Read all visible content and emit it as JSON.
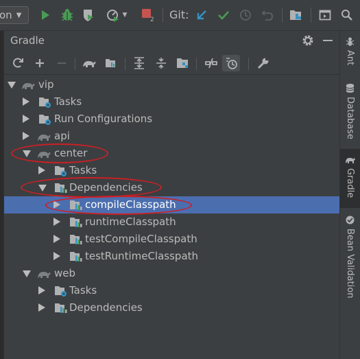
{
  "toolbar": {
    "run_config_label": "on",
    "git_label": "Git:",
    "notification_count": "2"
  },
  "panel": {
    "title": "Gradle"
  },
  "tree": {
    "vip": "vip",
    "vip_tasks": "Tasks",
    "vip_runconf": "Run Configurations",
    "api": "api",
    "center": "center",
    "center_tasks": "Tasks",
    "center_deps": "Dependencies",
    "compileClasspath": "compileClasspath",
    "runtimeClasspath": "runtimeClasspath",
    "testCompileClasspath": "testCompileClasspath",
    "testRuntimeClasspath": "testRuntimeClasspath",
    "web": "web",
    "web_tasks": "Tasks",
    "web_deps": "Dependencies"
  },
  "side_tabs": {
    "ant": "Ant",
    "database": "Database",
    "gradle": "Gradle",
    "bean_validation": "Bean Validation"
  },
  "colors": {
    "panel_bg": "#3c3f41",
    "selection": "#4b6eaf",
    "annotation": "#cc1f25",
    "run_green": "#499c54",
    "stop_red": "#c75450",
    "vcs_blue": "#3592c4"
  }
}
